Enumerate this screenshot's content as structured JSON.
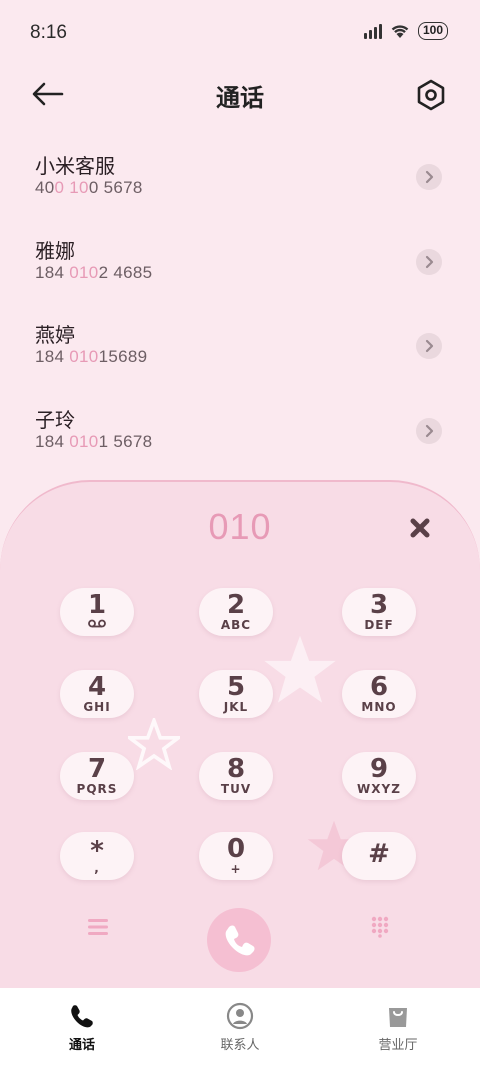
{
  "status_bar": {
    "time": "8:16",
    "battery": "100"
  },
  "header": {
    "title": "通话"
  },
  "contacts": [
    {
      "name": "小米客服",
      "number_parts": [
        "40",
        "0 10",
        "0 5678"
      ]
    },
    {
      "name": "雅娜",
      "number_parts": [
        "184 ",
        "010",
        "2 4685"
      ]
    },
    {
      "name": "燕婷",
      "number_parts": [
        "184 ",
        "010",
        "15689"
      ]
    },
    {
      "name": "子玲",
      "number_parts": [
        "184 ",
        "010",
        "1 5678"
      ]
    }
  ],
  "dialpad": {
    "value": "010",
    "keys": [
      {
        "digit": "1",
        "letters": ""
      },
      {
        "digit": "2",
        "letters": "ABC"
      },
      {
        "digit": "3",
        "letters": "DEF"
      },
      {
        "digit": "4",
        "letters": "GHI"
      },
      {
        "digit": "5",
        "letters": "JKL"
      },
      {
        "digit": "6",
        "letters": "MNO"
      },
      {
        "digit": "7",
        "letters": "PQRS"
      },
      {
        "digit": "8",
        "letters": "TUV"
      },
      {
        "digit": "9",
        "letters": "WXYZ"
      },
      {
        "digit": "*",
        "letters": ","
      },
      {
        "digit": "0",
        "letters": "+"
      },
      {
        "digit": "#",
        "letters": ""
      }
    ]
  },
  "bottom_nav": [
    {
      "label": "通话",
      "icon": "phone-icon",
      "active": true
    },
    {
      "label": "联系人",
      "icon": "person-icon",
      "active": false
    },
    {
      "label": "营业厅",
      "icon": "shopping-bag-icon",
      "active": false
    }
  ],
  "colors": {
    "accent": "#e79ab6",
    "background": "#fbe9ef",
    "dialpad_bg": "#f8dce6",
    "call_button": "#f5bfd2"
  }
}
